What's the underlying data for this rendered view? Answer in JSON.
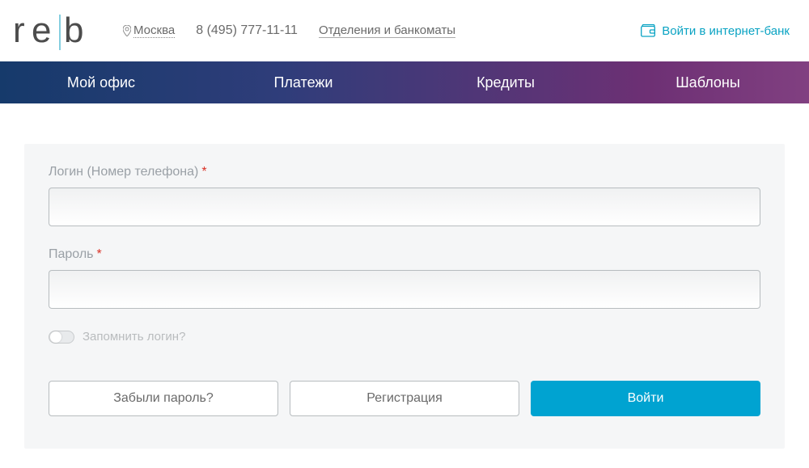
{
  "header": {
    "city": "Москва",
    "phone": "8 (495) 777-11-11",
    "branches": "Отделения и банкоматы",
    "inet_login": "Войти в интернет-банк"
  },
  "nav": {
    "items": [
      "Мой офис",
      "Платежи",
      "Кредиты",
      "Шаблоны"
    ]
  },
  "form": {
    "login_label": "Логин (Номер телефона)",
    "password_label": "Пароль",
    "required_mark": "*",
    "remember_label": "Запомнить логин?"
  },
  "actions": {
    "forgot": "Забыли пароль?",
    "register": "Регистрация",
    "login": "Войти"
  }
}
